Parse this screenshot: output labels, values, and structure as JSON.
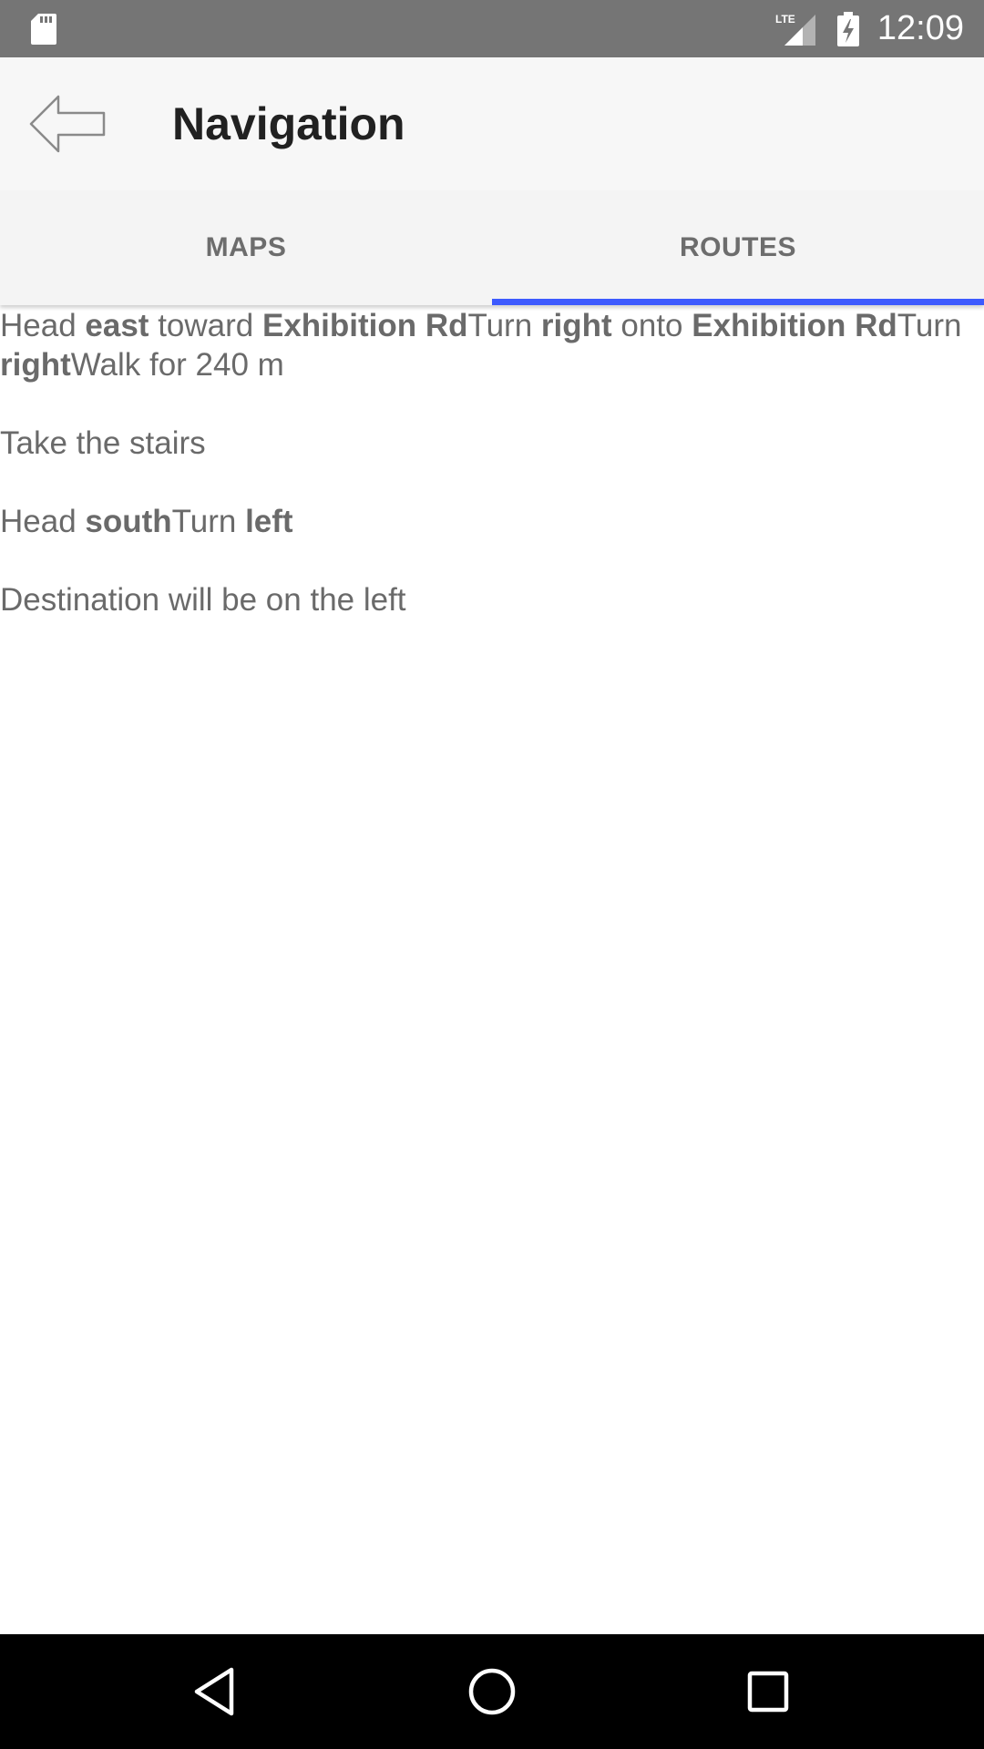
{
  "status_bar": {
    "network_label": "LTE",
    "time": "12:09",
    "icons": [
      "sd-card-icon",
      "lte-signal-icon",
      "battery-charging-icon"
    ]
  },
  "app_bar": {
    "title": "Navigation",
    "back_icon": "arrow-left-icon"
  },
  "tabs": [
    {
      "label": "MAPS",
      "active": false
    },
    {
      "label": "ROUTES",
      "active": true
    }
  ],
  "accent_color": "#3d5afe",
  "route_steps": [
    {
      "segments": [
        {
          "text": "Head ",
          "bold": false
        },
        {
          "text": "east",
          "bold": true
        },
        {
          "text": " toward ",
          "bold": false
        },
        {
          "text": "Exhibition Rd",
          "bold": true
        },
        {
          "text": "Turn ",
          "bold": false
        },
        {
          "text": "right",
          "bold": true
        },
        {
          "text": " onto ",
          "bold": false
        },
        {
          "text": "Exhibition Rd",
          "bold": true
        },
        {
          "text": "Turn ",
          "bold": false
        },
        {
          "text": "right",
          "bold": true
        },
        {
          "text": "Walk for 240 m",
          "bold": false
        }
      ]
    },
    {
      "segments": [
        {
          "text": "Take the stairs",
          "bold": false
        }
      ]
    },
    {
      "segments": [
        {
          "text": "Head ",
          "bold": false
        },
        {
          "text": "south",
          "bold": true
        },
        {
          "text": "Turn ",
          "bold": false
        },
        {
          "text": "left",
          "bold": true
        }
      ]
    },
    {
      "segments": [
        {
          "text": "Destination will be on the left",
          "bold": false
        }
      ]
    }
  ],
  "system_nav": {
    "icons": [
      "back-triangle-icon",
      "home-circle-icon",
      "recents-square-icon"
    ]
  }
}
